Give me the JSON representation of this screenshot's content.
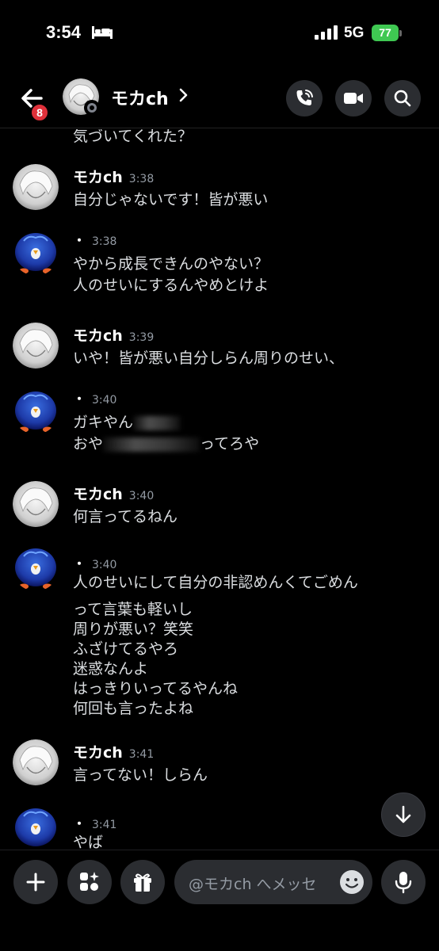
{
  "status_bar": {
    "time": "3:54",
    "network": "5G",
    "battery": "77"
  },
  "header": {
    "unread_badge": "8",
    "title": "モカch"
  },
  "cut_message": "気づいてくれた？",
  "messages": [
    {
      "author": "モカch",
      "time": "3:38",
      "lines": [
        "自分じゃないです！皆が悪い"
      ],
      "avatar": "white-hair-avatar"
    },
    {
      "author": "・",
      "time": "3:38",
      "lines": [
        "やから成長できんのやない？",
        "人のせいにするんやめとけよ"
      ],
      "avatar": "blue-penguin-avatar"
    },
    {
      "author": "モカch",
      "time": "3:39",
      "lines": [
        "いや！皆が悪い自分しらん周りのせい、"
      ],
      "avatar": "white-hair-avatar"
    },
    {
      "author": "・",
      "time": "3:40",
      "lines": [
        "ガキやん",
        "おや",
        "ってろや"
      ],
      "avatar": "blue-penguin-avatar"
    },
    {
      "author": "モカch",
      "time": "3:40",
      "lines": [
        "何言ってるねん"
      ],
      "avatar": "white-hair-avatar"
    },
    {
      "author": "・",
      "time": "3:40",
      "lines": [
        "人のせいにして自分の非認めんくてごめん",
        "って言葉も軽いし",
        "周りが悪い？笑笑",
        "ふざけてるやろ",
        "迷惑なんよ",
        "はっきりいってるやんね",
        "何回も言ったよね"
      ],
      "avatar": "blue-penguin-avatar"
    },
    {
      "author": "モカch",
      "time": "3:41",
      "lines": [
        "言ってない！しらん"
      ],
      "avatar": "white-hair-avatar"
    },
    {
      "author": "・",
      "time": "3:41",
      "lines": [
        "やば"
      ],
      "avatar": "blue-penguin-avatar"
    }
  ],
  "composer": {
    "placeholder": "@モカch へメッセ"
  },
  "icons": {
    "back": "arrow-left-icon",
    "voice_call": "phone-call-icon",
    "video_call": "video-camera-icon",
    "search": "search-icon",
    "scroll_down": "arrow-down-icon",
    "add": "plus-icon",
    "apps": "sparkle-apps-icon",
    "gift": "gift-icon",
    "emoji": "emoji-icon",
    "mic": "microphone-icon"
  },
  "colors": {
    "background": "#000000",
    "surface": "#2b2d31",
    "unread_badge": "#e0303a",
    "battery": "#3fc852",
    "muted_text": "#949ba4"
  }
}
